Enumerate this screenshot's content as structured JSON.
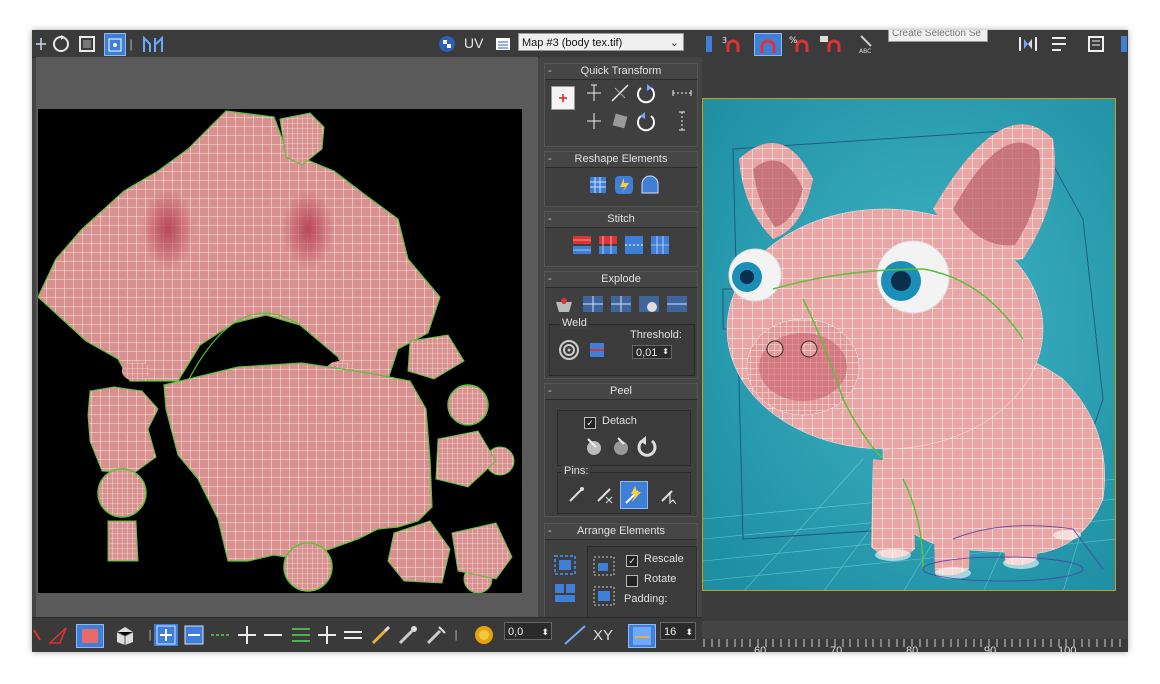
{
  "colors": {
    "accent": "#3f7fd8",
    "uv_fill": "#d9918f",
    "seam": "#58c23a",
    "viewport_bg": "#2aa0b3",
    "pig": "#e5a3a3"
  },
  "toolbar": {
    "uv_label": "UV",
    "map_select": "Map #3 (body tex.tif)",
    "selection_set_placeholder": "Create Selection Se",
    "icons": [
      "move-icon",
      "rotate-icon",
      "scale-icon",
      "freeform-icon",
      "mirror-icon",
      "checker-icon",
      "list-icon"
    ]
  },
  "panel": {
    "quick_transform": {
      "title": "Quick Transform"
    },
    "reshape": {
      "title": "Reshape Elements"
    },
    "stitch": {
      "title": "Stitch"
    },
    "explode": {
      "title": "Explode",
      "weld_label": "Weld",
      "threshold_label": "Threshold:",
      "threshold_value": "0,01"
    },
    "peel": {
      "title": "Peel",
      "detach_label": "Detach",
      "detach_checked": true,
      "pins_label": "Pins:"
    },
    "arrange": {
      "title": "Arrange Elements",
      "rescale_label": "Rescale",
      "rescale_checked": true,
      "rotate_label": "Rotate",
      "rotate_checked": false,
      "padding_label": "Padding:"
    }
  },
  "bottom": {
    "spinner_value": "0,0",
    "xy_label": "XY",
    "count_value": "16"
  },
  "timeline": {
    "ticks": [
      "60",
      "70",
      "80",
      "90",
      "100"
    ]
  }
}
